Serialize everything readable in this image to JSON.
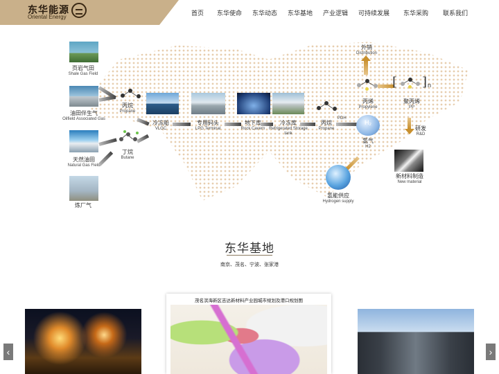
{
  "logo": {
    "cn": "东华能源",
    "en": "Oriental Energy"
  },
  "nav": [
    "首页",
    "东华使命",
    "东华动态",
    "东华基地",
    "产业逻辑",
    "可持续发展",
    "东华采购",
    "联系我们"
  ],
  "flow": {
    "sources": [
      {
        "cn": "页岩气田",
        "en": "Shale Gas Field"
      },
      {
        "cn": "油田伴生气",
        "en": "Oilfield Associated Gas"
      },
      {
        "cn": "天然油田",
        "en": "Natural Gas Field"
      },
      {
        "cn": "炼厂气",
        "en": ""
      }
    ],
    "propane1": {
      "cn": "丙烷",
      "en": "Propane"
    },
    "butane": {
      "cn": "丁烷",
      "en": "Butane"
    },
    "vlgc": {
      "cn": "冷冻船",
      "en": "VLGC"
    },
    "terminal": {
      "cn": "专用码头",
      "en": "LPG Terminal"
    },
    "cavern": {
      "cn": "地下库",
      "en": "Rock Cavern"
    },
    "storage": {
      "cn": "冷冻库",
      "en": "Refrigerated Storage tank"
    },
    "propane2": {
      "cn": "丙烷",
      "en": "Propane"
    },
    "pdh": "PDH",
    "propylene": {
      "cn": "丙烯",
      "en": "Propylene"
    },
    "distribution": {
      "cn": "外销",
      "en": "Distribution"
    },
    "pp": {
      "cn": "聚丙烯",
      "en": "PP"
    },
    "pp_sub": "n",
    "rd": {
      "cn": "研发",
      "en": "R&D"
    },
    "newmat": {
      "cn": "新材料制造",
      "en": "New material"
    },
    "h2": {
      "cn": "氢气",
      "en": "H2",
      "ball": "H₂"
    },
    "hsupply": {
      "cn": "氢能供应",
      "en": "Hydrogen supply"
    }
  },
  "base": {
    "title": "东华基地",
    "subtitle": "南京、茂名、宁波、张家港",
    "plan_title": "茂名滨海新区吉达新材料产业园城市规划及港口规划图",
    "prev": "‹",
    "next": "›"
  },
  "colors": {
    "accent": "#c9b08a",
    "arrow_gold": "#c8902e",
    "map_dot": "#e4c9a6"
  }
}
